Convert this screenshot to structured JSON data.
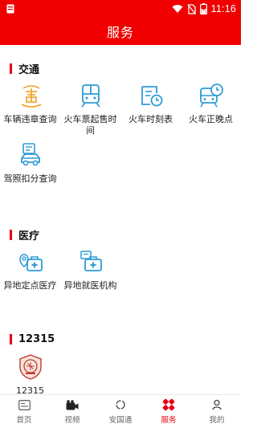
{
  "status": {
    "time": "11:16",
    "battery_level": 0.55
  },
  "header": {
    "title": "服务"
  },
  "sections": [
    {
      "title": "交通",
      "items": [
        {
          "label": "车辆违章查询",
          "icon": "vehicle-violation-icon"
        },
        {
          "label": "火车票起售时间",
          "icon": "train-ticket-icon"
        },
        {
          "label": "火车时刻表",
          "icon": "train-schedule-icon"
        },
        {
          "label": "火车正晚点",
          "icon": "train-delay-icon"
        },
        {
          "label": "驾照扣分查询",
          "icon": "license-points-icon"
        }
      ]
    },
    {
      "title": "医疗",
      "items": [
        {
          "label": "异地定点医疗",
          "icon": "remote-medical-icon"
        },
        {
          "label": "异地就医机构",
          "icon": "remote-hospital-icon"
        }
      ]
    },
    {
      "title": "12315",
      "items": [
        {
          "label": "12315",
          "icon": "consumer-complaint-badge-icon"
        }
      ]
    }
  ],
  "tabbar": {
    "tabs": [
      {
        "label": "首页",
        "icon": "home-icon"
      },
      {
        "label": "视频",
        "icon": "video-camera-icon"
      },
      {
        "label": "安国通",
        "icon": "circle-icon"
      },
      {
        "label": "服务",
        "icon": "services-icon",
        "active": true
      },
      {
        "label": "我的",
        "icon": "person-icon"
      }
    ]
  },
  "colors": {
    "brand_red": "#f00000",
    "accent_blue": "#2e9bd6",
    "accent_orange": "#f0a020",
    "active_tab": "#e60012"
  }
}
